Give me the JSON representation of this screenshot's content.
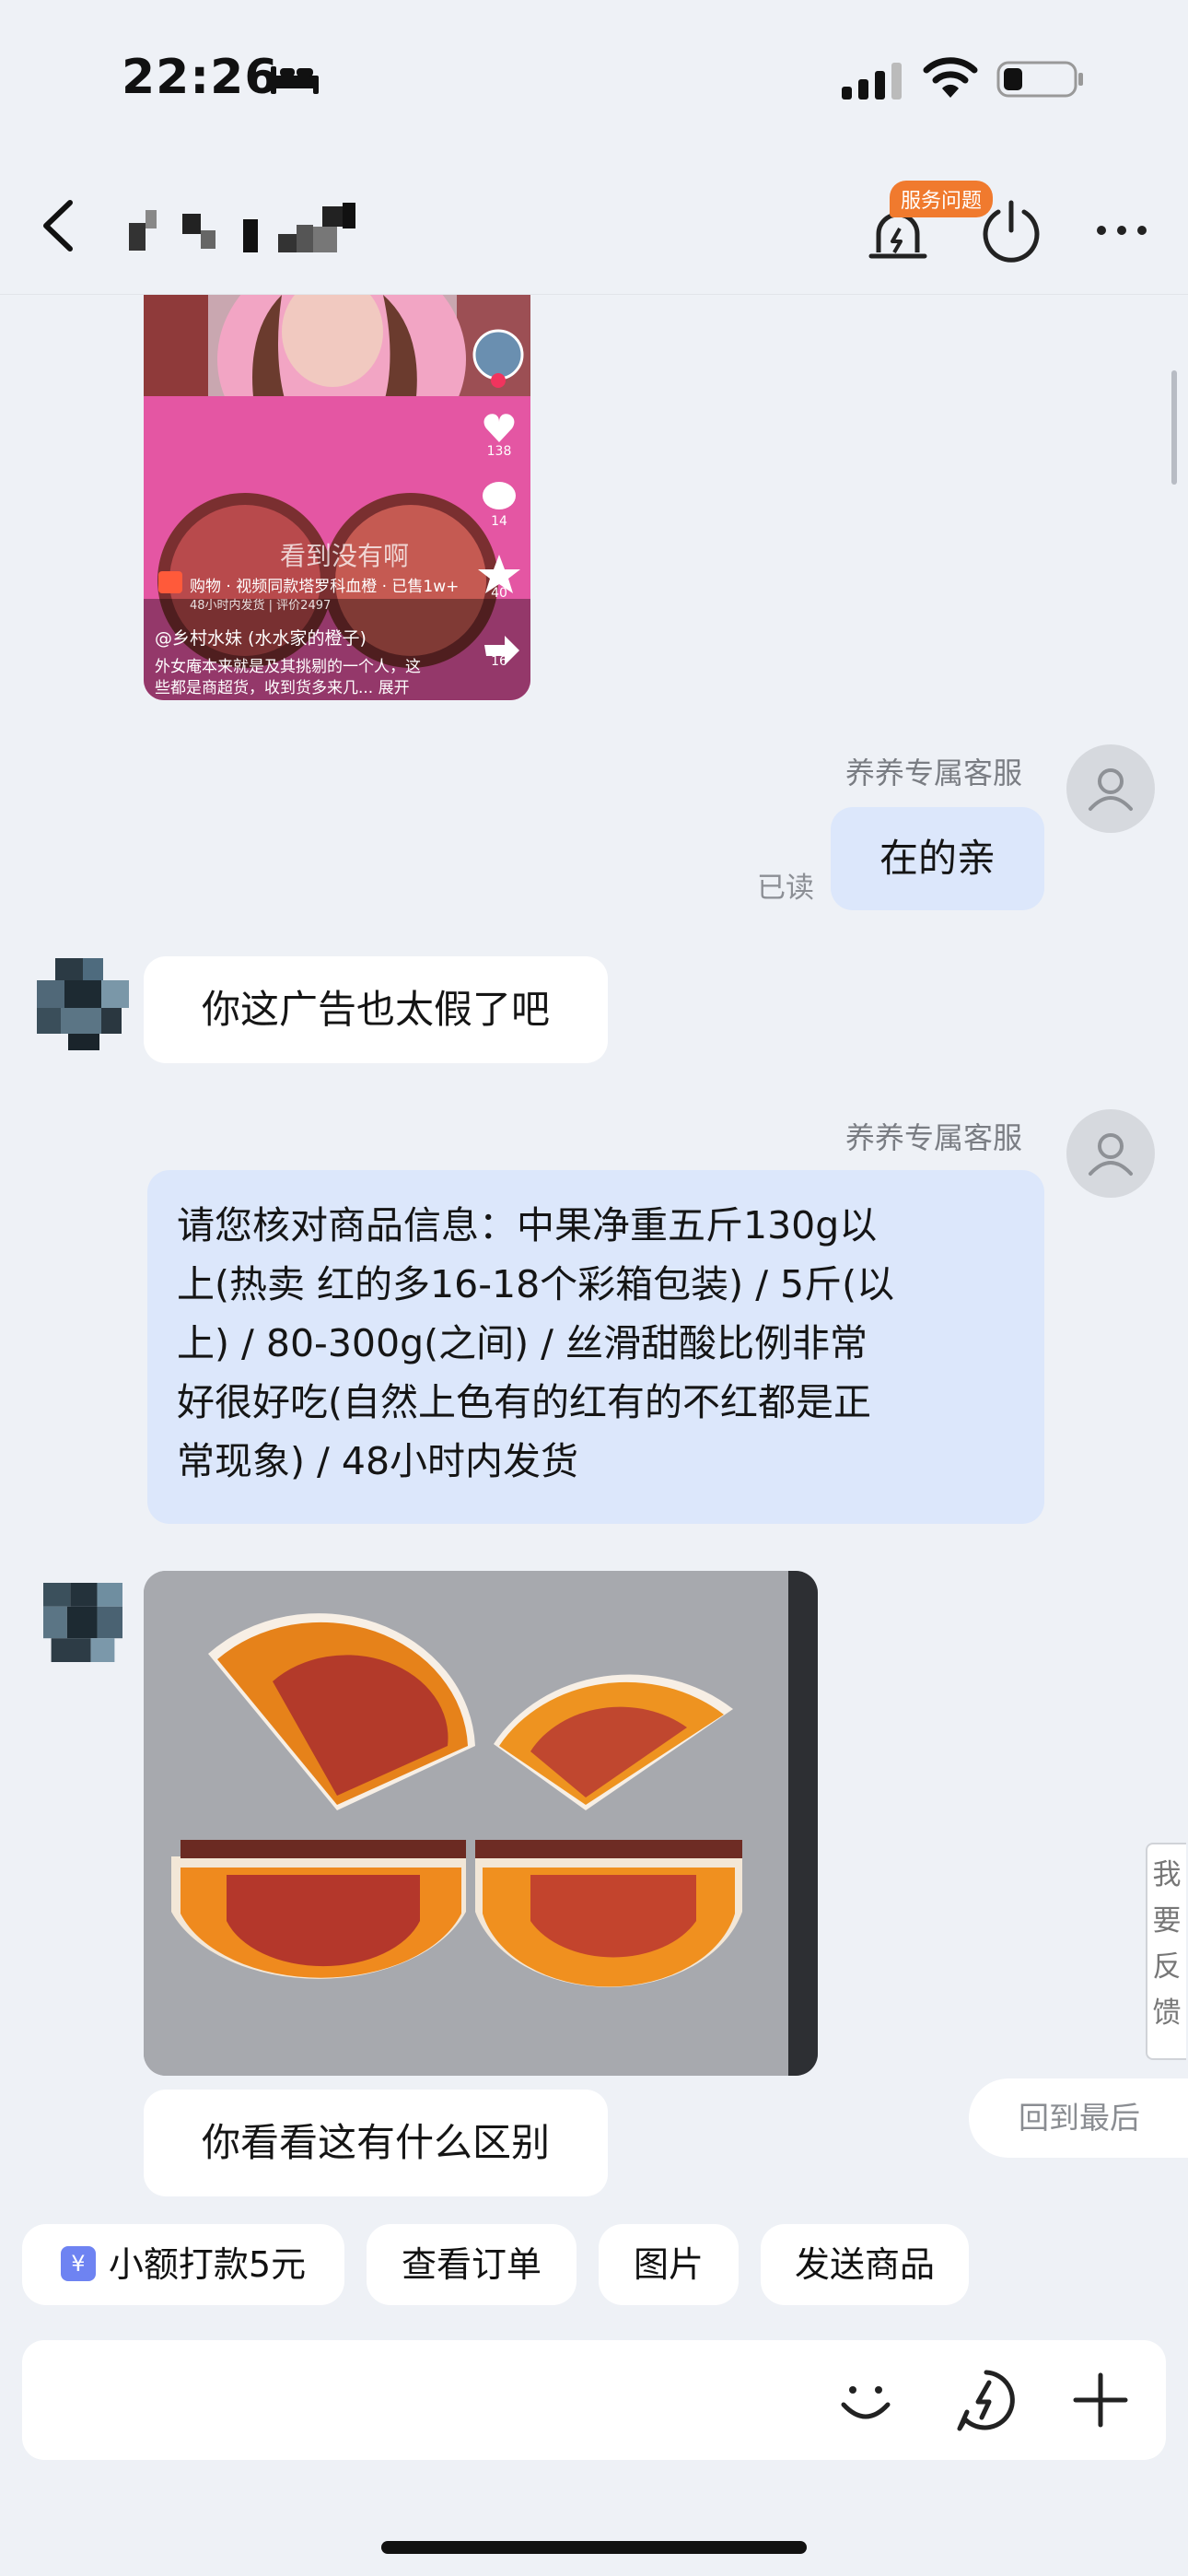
{
  "status_bar": {
    "time": "22:26"
  },
  "header": {
    "badge": "服务问题"
  },
  "video_card": {
    "overlay_text": "看到没有啊",
    "shop_line": "购物 · 视频同款塔罗科血橙 · 已售1w+",
    "shop_sub": "48小时内发货 | 评价2497",
    "author": "@乡村水妹 (水水家的橙子)",
    "desc1": "外女庵本来就是及其挑剔的一个人，这",
    "desc2": "些都是商超货，收到货多来几... 展开",
    "likes": "138",
    "comments": "14",
    "favs": "40",
    "shares": "16"
  },
  "messages": [
    {
      "sender": "养养专属客服",
      "text": "在的亲",
      "read": "已读"
    },
    {
      "text": "你这广告也太假了吧"
    },
    {
      "sender": "养养专属客服",
      "lines": [
        "请您核对商品信息：中果净重五斤130g以",
        "上(热卖 红的多16-18个彩箱包装) / 5斤(以",
        "上) / 80-300g(之间) / 丝滑甜酸比例非常",
        "好很好吃(自然上色有的红有的不红都是正",
        "常现象) / 48小时内发货"
      ]
    },
    {
      "text": "你看看这有什么区别"
    }
  ],
  "side": {
    "feedback": [
      "我",
      "要",
      "反",
      "馈"
    ],
    "back_to_last": "回到最后"
  },
  "quick_actions": {
    "pay": "小额打款5元",
    "order": "查看订单",
    "image": "图片",
    "send": "发送商品"
  },
  "input": {
    "placeholder": ""
  },
  "colors": {
    "agent_bubble": "#dce7fb",
    "user_bubble": "#ffffff",
    "background": "#eef1f6",
    "badge": "#f07a2e",
    "pay_icon": "#6e83f2"
  }
}
